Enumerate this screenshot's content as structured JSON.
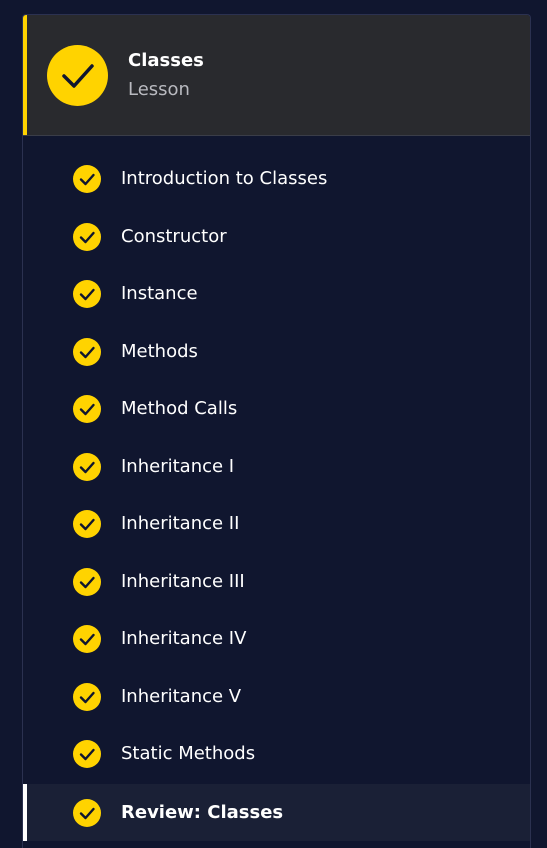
{
  "lesson": {
    "title": "Classes",
    "subtitle": "Lesson",
    "status_icon": "check-circle-icon",
    "accent_color": "#ffd300"
  },
  "items": [
    {
      "label": "Introduction to Classes",
      "completed": true,
      "active": false
    },
    {
      "label": "Constructor",
      "completed": true,
      "active": false
    },
    {
      "label": "Instance",
      "completed": true,
      "active": false
    },
    {
      "label": "Methods",
      "completed": true,
      "active": false
    },
    {
      "label": "Method Calls",
      "completed": true,
      "active": false
    },
    {
      "label": "Inheritance I",
      "completed": true,
      "active": false
    },
    {
      "label": "Inheritance II",
      "completed": true,
      "active": false
    },
    {
      "label": "Inheritance III",
      "completed": true,
      "active": false
    },
    {
      "label": "Inheritance IV",
      "completed": true,
      "active": false
    },
    {
      "label": "Inheritance V",
      "completed": true,
      "active": false
    },
    {
      "label": "Static Methods",
      "completed": true,
      "active": false
    },
    {
      "label": "Review: Classes",
      "completed": true,
      "active": true
    }
  ]
}
